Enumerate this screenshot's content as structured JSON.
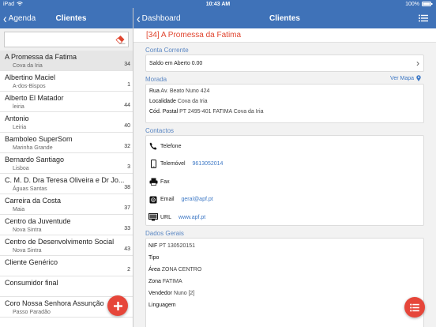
{
  "status": {
    "carrier": "iPad",
    "time": "10:43 AM",
    "battery": "100%"
  },
  "left_nav": {
    "back_label": "Agenda",
    "title": "Clientes"
  },
  "right_nav": {
    "back_label": "Dashboard",
    "title": "Clientes"
  },
  "search": {
    "placeholder": ""
  },
  "clients": [
    {
      "name": "A Promessa da Fatima",
      "location": "Cova da Iria",
      "count": "34",
      "selected": true
    },
    {
      "name": "Albertino Maciel",
      "location": "A-dos-Bispos",
      "count": "1"
    },
    {
      "name": "Alberto El Matador",
      "location": "leiria",
      "count": "44"
    },
    {
      "name": "Antonio",
      "location": "Leiria",
      "count": "40"
    },
    {
      "name": "Bamboleo SuperSom",
      "location": "Marinha Grande",
      "count": "32"
    },
    {
      "name": "Bernardo Santiago",
      "location": "Lisboa",
      "count": "3"
    },
    {
      "name": "C. M. D. Dra Teresa Oliveira e Dr Jo...",
      "location": "Águas Santas",
      "count": "38"
    },
    {
      "name": "Carreira da Costa",
      "location": "Maia",
      "count": "37"
    },
    {
      "name": "Centro da Juventude",
      "location": "Nova Sintra",
      "count": "33"
    },
    {
      "name": "Centro de Desenvolvimento Social",
      "location": "Nova Sintra",
      "count": "43"
    },
    {
      "name": "Cliente Genérico",
      "location": "",
      "count": "2"
    },
    {
      "name": "Consumidor final",
      "location": "",
      "count": ""
    },
    {
      "name": "Coro Nossa Senhora Assunção",
      "location": "Passo Paradão",
      "count": ""
    }
  ],
  "detail": {
    "title": "[34] A Promessa da Fatima",
    "conta_corrente": {
      "label": "Conta Corrente",
      "saldo": "Saldo em Aberto 0.00"
    },
    "morada": {
      "label": "Morada",
      "ver_mapa": "Ver Mapa",
      "rua_label": "Rua",
      "rua": "Av. Beato Nuno 424",
      "localidade_label": "Localidade",
      "localidade": "Cova da Iria",
      "cp_label": "Cód. Postal",
      "cp": "PT 2495-401 FATIMA Cova da Iria"
    },
    "contactos": {
      "label": "Contactos",
      "telefone_label": "Telefone",
      "telefone": "",
      "telemovel_label": "Telemóvel",
      "telemovel": "9613052014",
      "fax_label": "Fax",
      "fax": "",
      "email_label": "Email",
      "email": "geral@apf.pt",
      "url_label": "URL",
      "url": "www.apf.pt"
    },
    "dados_gerais": {
      "label": "Dados Gerais",
      "nif_label": "NIF",
      "nif": "PT 130520151",
      "tipo_label": "Tipo",
      "tipo": "",
      "area_label": "Área",
      "area": "ZONA CENTRO",
      "zona_label": "Zona",
      "zona": "FATIMA",
      "vendedor_label": "Vendedor",
      "vendedor": "Nuno [2]",
      "linguagem_label": "Linguagem",
      "linguagem": ""
    }
  },
  "colors": {
    "nav": "#3f72b8",
    "accent": "#e0452f",
    "link": "#3d78c5",
    "fab": "#e6463a"
  },
  "icons": [
    "wifi-icon",
    "battery-icon",
    "eraser-icon",
    "menu-list-icon",
    "map-pin-icon",
    "phone-icon",
    "mobile-icon",
    "fax-icon",
    "email-icon",
    "url-icon",
    "plus-icon",
    "list-icon"
  ]
}
